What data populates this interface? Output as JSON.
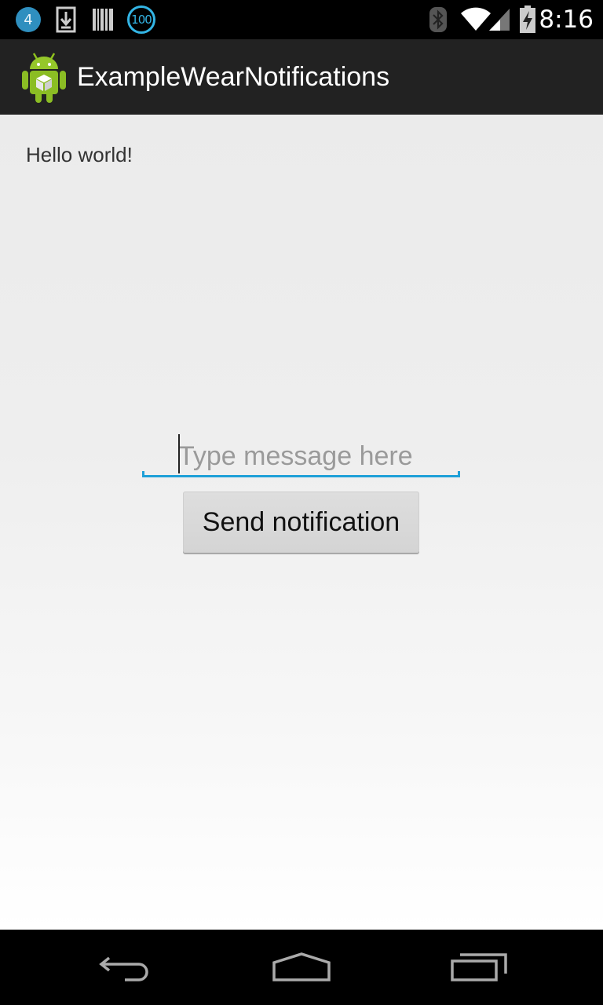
{
  "status_bar": {
    "notification_count": "4",
    "battery_badge": "100",
    "time": "8:16",
    "icons": [
      "notification-count-icon",
      "download-icon",
      "barcode-icon",
      "battery-100-icon",
      "bluetooth-icon",
      "wifi-icon",
      "signal-icon",
      "battery-charging-icon"
    ]
  },
  "action_bar": {
    "title": "ExampleWearNotifications",
    "icon": "android-app-icon"
  },
  "main": {
    "hello_text": "Hello world!",
    "message_input": {
      "value": "",
      "placeholder": "Type message here"
    },
    "send_button_label": "Send notification"
  },
  "nav_bar": {
    "buttons": [
      "back-icon",
      "home-icon",
      "recents-icon"
    ]
  },
  "colors": {
    "accent": "#33b5e5",
    "input_underline": "#1ea0d8",
    "action_bar": "#222222"
  }
}
